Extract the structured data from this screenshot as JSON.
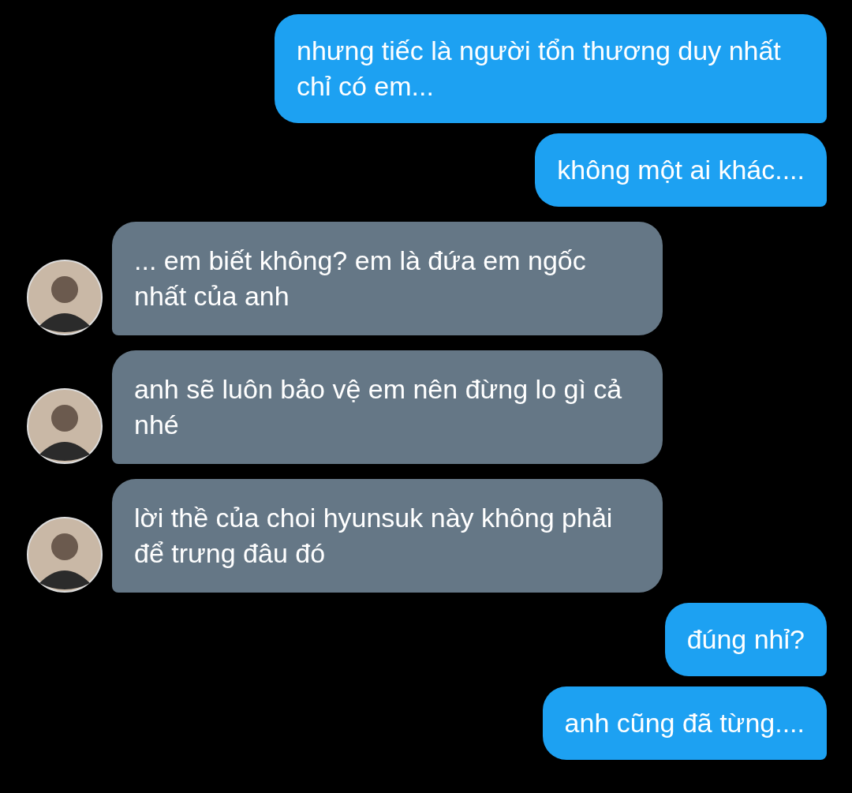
{
  "messages": [
    {
      "kind": "sent",
      "text": "nhưng tiếc là người tổn thương duy nhất chỉ có em..."
    },
    {
      "kind": "sent",
      "text": "không một ai khác...."
    },
    {
      "kind": "received",
      "text": "... em biết không? em là đứa em ngốc nhất của anh"
    },
    {
      "kind": "received",
      "text": "anh sẽ luôn bảo vệ em nên đừng lo gì cả nhé"
    },
    {
      "kind": "received",
      "text": "lời thề của choi hyunsuk này không phải để trưng đâu đó"
    },
    {
      "kind": "sent",
      "text": "đúng nhỉ?"
    },
    {
      "kind": "sent",
      "text": "anh cũng đã từng...."
    }
  ]
}
